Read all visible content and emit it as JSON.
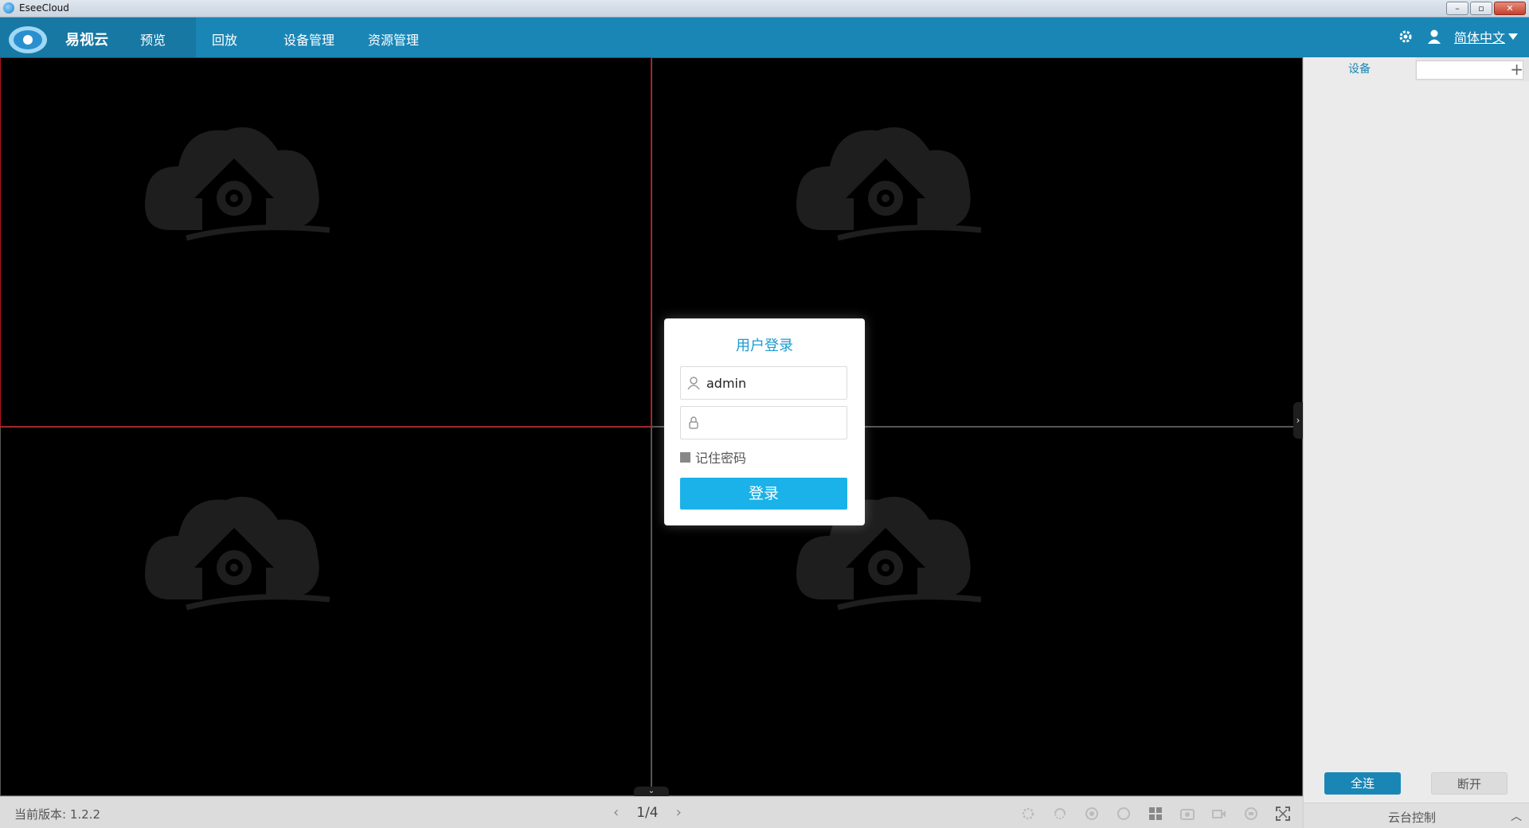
{
  "window": {
    "title": "EseeCloud",
    "minimize": "–",
    "maximize": "▫",
    "close": "✕"
  },
  "nav": {
    "brand": "易视云",
    "items": [
      "预览",
      "回放",
      "设备管理",
      "资源管理"
    ],
    "language": "简体中文"
  },
  "status": {
    "version": "当前版本: 1.2.2",
    "page": "1/4",
    "prev": "‹",
    "next": "›"
  },
  "panel": {
    "tab_device": "设备",
    "add": "+",
    "connect_all": "全连",
    "disconnect": "断开",
    "ptz": "云台控制",
    "ptz_chevron": "︿"
  },
  "login": {
    "title": "用户登录",
    "username": "admin",
    "password": "",
    "remember": "记住密码",
    "submit": "登录"
  },
  "colors": {
    "nav": "#1a86b6",
    "accent": "#1ab2e8",
    "active_cell": "#b3141b"
  },
  "icons": [
    "settings-icon",
    "user-icon",
    "dropdown-icon",
    "user-field-icon",
    "lock-icon",
    "camera-placeholder-icon"
  ]
}
